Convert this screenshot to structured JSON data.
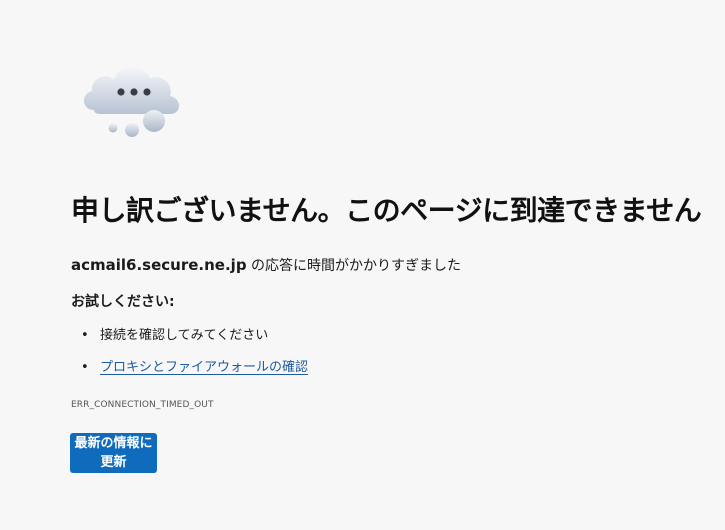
{
  "error_page": {
    "illustration_icon": "cloud-thinking-icon",
    "title": "申し訳ございません。このページに到達できません",
    "detail_host": "acmail6.secure.ne.jp",
    "detail_message": " の応答に時間がかかりすぎました",
    "try_heading": "お試しください:",
    "suggestions": [
      {
        "text": "接続を確認してみてください",
        "is_link": false
      },
      {
        "text": "プロキシとファイアウォールの確認",
        "is_link": true
      }
    ],
    "error_code": "ERR_CONNECTION_TIMED_OUT",
    "refresh_button_label": "最新の情報に更新"
  },
  "colors": {
    "background": "#f7f7f7",
    "accent_button": "#0f6cbd",
    "link": "#1d5a9e"
  }
}
